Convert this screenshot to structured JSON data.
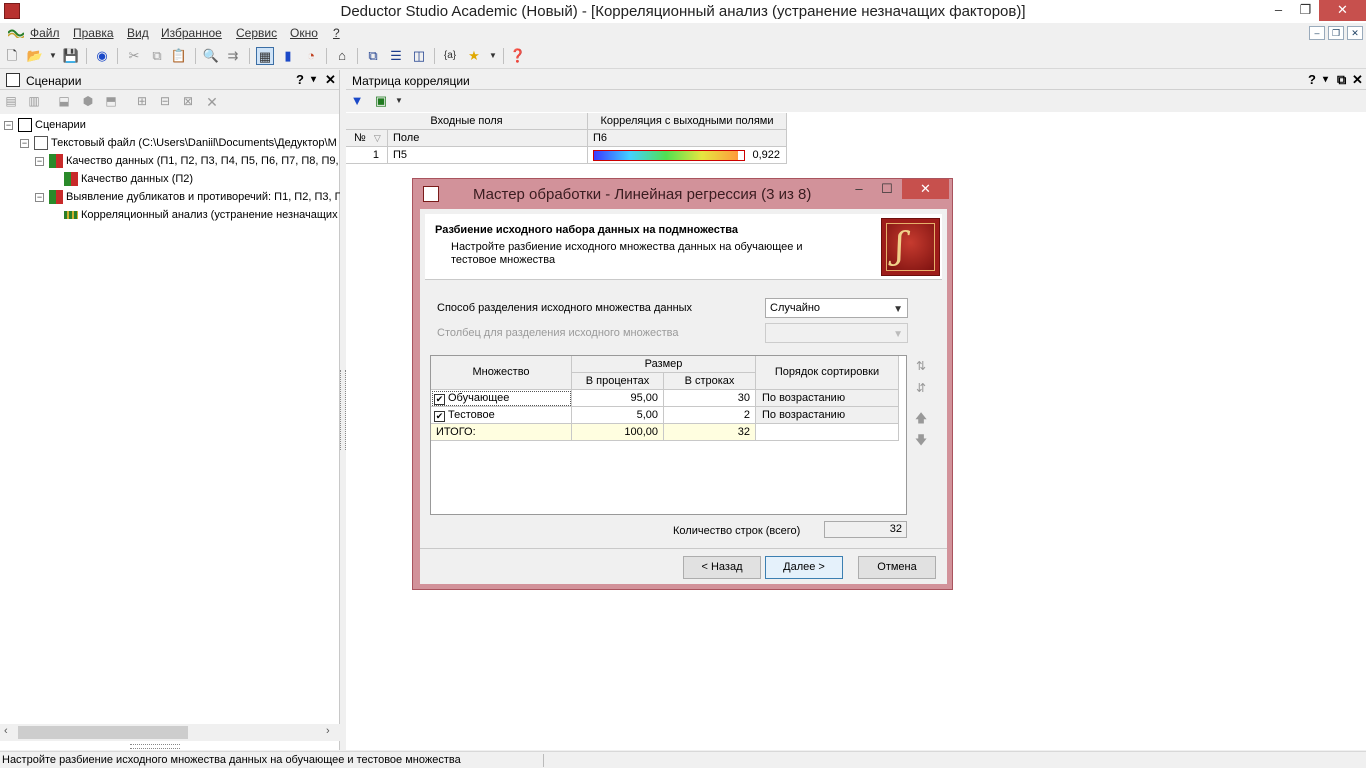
{
  "window": {
    "title": "Deductor Studio Academic (Новый) - [Корреляционный анализ (устранение незначащих факторов)]",
    "controls": [
      "–",
      "❐",
      "✕"
    ]
  },
  "menu": {
    "items": [
      "Файл",
      "Правка",
      "Вид",
      "Избранное",
      "Сервис",
      "Окно",
      "?"
    ]
  },
  "scenarios_panel": {
    "title": "Сценарии",
    "help": "?",
    "pin": "▾",
    "close": "✕",
    "tree": [
      {
        "label": "Сценарии",
        "level": 0
      },
      {
        "label": "Текстовый файл (C:\\Users\\Daniil\\Documents\\Дедуктор\\М",
        "level": 1
      },
      {
        "label": "Качество данных (П1, П2, П3, П4, П5, П6, П7, П8, П9,",
        "level": 2
      },
      {
        "label": "Качество данных (П2)",
        "level": 3
      },
      {
        "label": "Выявление дубликатов и противоречий: П1, П2, П3, П",
        "level": 2
      },
      {
        "label": "Корреляционный анализ (устранение незначащих",
        "level": 3
      }
    ]
  },
  "matrix_panel": {
    "title": "Матрица корреляции",
    "help": "?",
    "pin": "▾",
    "float": "⧉",
    "close": "✕",
    "table": {
      "group_inputs": "Входные поля",
      "group_corr": "Корреляция с выходными полями",
      "col_num": "№",
      "col_field": "Поле",
      "col_out": "П6",
      "rows": [
        {
          "num": "1",
          "field": "П5",
          "value": "0,922",
          "fill": 0.96
        }
      ]
    }
  },
  "dialog": {
    "title": "Мастер обработки - Линейная регрессия (3 из 8)",
    "header_title": "Разбиение исходного набора данных на подмножества",
    "header_sub": "Настройте разбиение исходного множества данных на обучающее и тестовое множества",
    "split_method_label": "Способ разделения исходного множества данных",
    "split_method_value": "Случайно",
    "split_column_label": "Столбец для разделения исходного множества",
    "split_column_value": "",
    "grid": {
      "col_set": "Множество",
      "col_size": "Размер",
      "col_percent": "В процентах",
      "col_rows": "В строках",
      "col_sort": "Порядок сортировки",
      "rows": [
        {
          "name": "Обучающее",
          "checked": true,
          "percent": "95,00",
          "rows": "30",
          "sort": "По возрастанию"
        },
        {
          "name": "Тестовое",
          "checked": true,
          "percent": "5,00",
          "rows": "2",
          "sort": "По возрастанию"
        }
      ],
      "total": {
        "name": "ИТОГО:",
        "percent": "100,00",
        "rows": "32"
      }
    },
    "row_count_label": "Количество строк (всего)",
    "row_count_value": "32",
    "buttons": {
      "back": "< Назад",
      "next": "Далее >",
      "cancel": "Отмена"
    }
  },
  "status": {
    "text": "Настройте разбиение исходного множества данных на обучающее и тестовое множества"
  }
}
